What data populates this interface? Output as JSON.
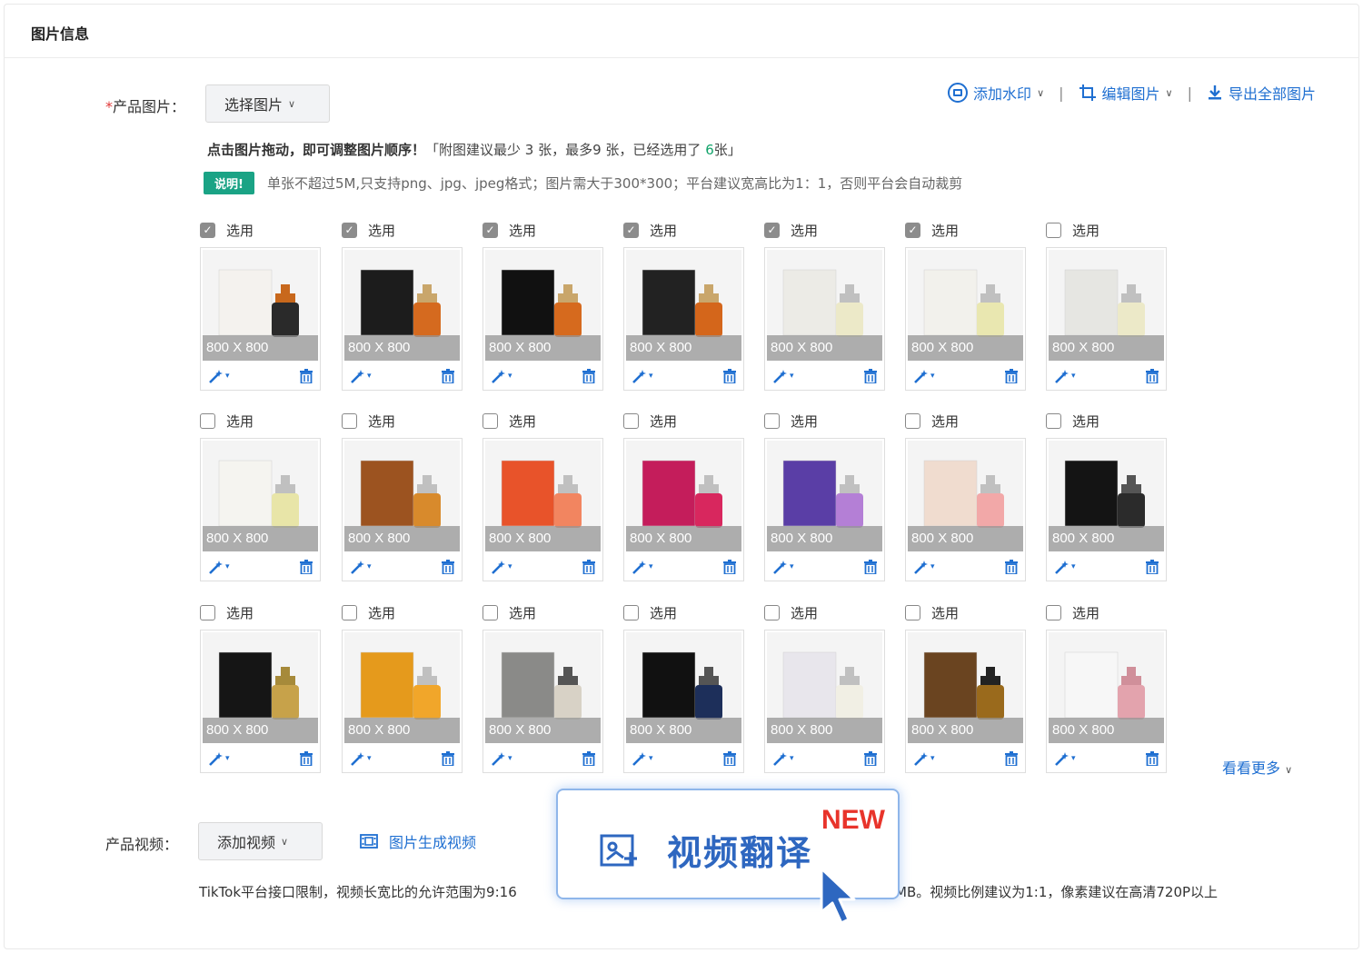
{
  "section": {
    "title": "图片信息"
  },
  "images_row": {
    "required_mark": "*",
    "label": "产品图片：",
    "select_button": "选择图片"
  },
  "toolbar": {
    "watermark": "添加水印",
    "edit": "编辑图片",
    "export": "导出全部图片",
    "separator": "|"
  },
  "hint": {
    "lead": "点击图片拖动，即可调整图片顺序！",
    "rule_prefix": "「附图建议最少 3 张，最多9 张，已经选用了 ",
    "count": "6",
    "rule_suffix": "张」"
  },
  "note": {
    "badge": "说明!",
    "text": "单张不超过5M,只支持png、jpg、jpeg格式；图片需大于300*300；平台建议宽高比为1：1，否则平台会自动裁剪"
  },
  "select_label": "选用",
  "size_label": "800 X 800",
  "images": [
    {
      "checked": true,
      "box": "#f4f2ee",
      "bottle": "#2a2a2a",
      "accent": "#c8681c"
    },
    {
      "checked": true,
      "box": "#1c1c1c",
      "bottle": "#d56a1f",
      "accent": "#c9a66b"
    },
    {
      "checked": true,
      "box": "#111111",
      "bottle": "#d66a1e",
      "accent": "#c9a66b"
    },
    {
      "checked": true,
      "box": "#222222",
      "bottle": "#d4661b",
      "accent": "#c9a66b"
    },
    {
      "checked": true,
      "box": "#ecebe6",
      "bottle": "#ece9c8",
      "accent": "#c0c0c0"
    },
    {
      "checked": true,
      "box": "#f2f1ec",
      "bottle": "#e9e7b0",
      "accent": "#c0c0c0"
    },
    {
      "checked": false,
      "box": "#e6e6e2",
      "bottle": "#ece9c8",
      "accent": "#c0c0c0"
    },
    {
      "checked": false,
      "box": "#f5f4f0",
      "bottle": "#e8e5a8",
      "accent": "#c0c0c0"
    },
    {
      "checked": false,
      "box": "#9c5320",
      "bottle": "#d88a2c",
      "accent": "#c0c0c0"
    },
    {
      "checked": false,
      "box": "#e8532a",
      "bottle": "#f28560",
      "accent": "#c0c0c0"
    },
    {
      "checked": false,
      "box": "#c41d5b",
      "bottle": "#d8275e",
      "accent": "#c0c0c0"
    },
    {
      "checked": false,
      "box": "#5a3ea6",
      "bottle": "#b47fd6",
      "accent": "#c0c0c0"
    },
    {
      "checked": false,
      "box": "#f0dccf",
      "bottle": "#f2a8a8",
      "accent": "#c0c0c0"
    },
    {
      "checked": false,
      "box": "#141414",
      "bottle": "#2b2b2b",
      "accent": "#555555"
    },
    {
      "checked": false,
      "box": "#151515",
      "bottle": "#c7a24a",
      "accent": "#a68a3a"
    },
    {
      "checked": false,
      "box": "#e59a1c",
      "bottle": "#f1a62a",
      "accent": "#c0c0c0"
    },
    {
      "checked": false,
      "box": "#8a8a88",
      "bottle": "#d8d2c6",
      "accent": "#555555"
    },
    {
      "checked": false,
      "box": "#111111",
      "bottle": "#1d2f5a",
      "accent": "#555555"
    },
    {
      "checked": false,
      "box": "#e8e6ec",
      "bottle": "#f1efe4",
      "accent": "#c0c0c0"
    },
    {
      "checked": false,
      "box": "#6a4420",
      "bottle": "#9a6a1c",
      "accent": "#222222"
    },
    {
      "checked": false,
      "box": "#f7f7f7",
      "bottle": "#e3a3ad",
      "accent": "#d08f9a"
    }
  ],
  "more_link": "看看更多",
  "video": {
    "label": "产品视频：",
    "add_button": "添加视频",
    "generate": "图片生成视频",
    "tip_left": "TikTok平台接口限制，视频长宽比的允许范围为",
    "tip_left_partial": "9:16",
    "tip_right": "MB。视频比例建议为1:1，像素建议在高清720P以上"
  },
  "promo": {
    "title": "视频翻译",
    "badge": "NEW"
  }
}
